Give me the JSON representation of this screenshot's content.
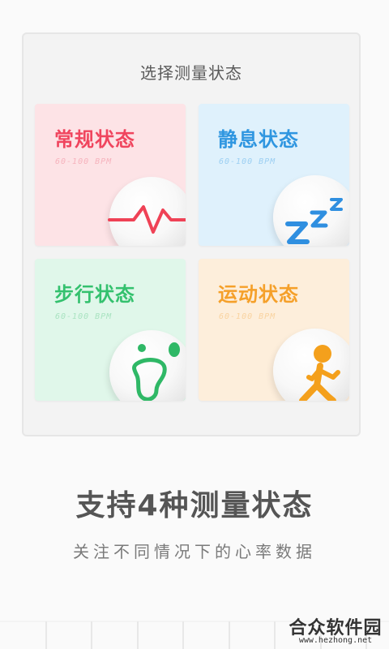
{
  "panel": {
    "title": "选择测量状态",
    "cards": [
      {
        "title": "常规状态",
        "range": "60-100 BPM",
        "title_color": "#f0455e",
        "range_color": "#f6b3bd",
        "bg": "#fde3e6",
        "icon": "heartbeat-icon"
      },
      {
        "title": "静息状态",
        "range": "60-100 BPM",
        "title_color": "#2f96e0",
        "range_color": "#9ccff2",
        "bg": "#dff1fc",
        "icon": "sleep-zzz-icon"
      },
      {
        "title": "步行状态",
        "range": "60-100 BPM",
        "title_color": "#34c16e",
        "range_color": "#a9e3c1",
        "bg": "#e0f7ea",
        "icon": "footprint-icon"
      },
      {
        "title": "运动状态",
        "range": "60-100 BPM",
        "title_color": "#f5a02a",
        "range_color": "#f9d3a0",
        "bg": "#fdeedb",
        "icon": "running-person-icon"
      }
    ]
  },
  "headline": "支持4种测量状态",
  "subline": "关注不同情况下的心率数据",
  "watermark": {
    "name": "合众软件园",
    "url": "www.hezhong.net"
  }
}
